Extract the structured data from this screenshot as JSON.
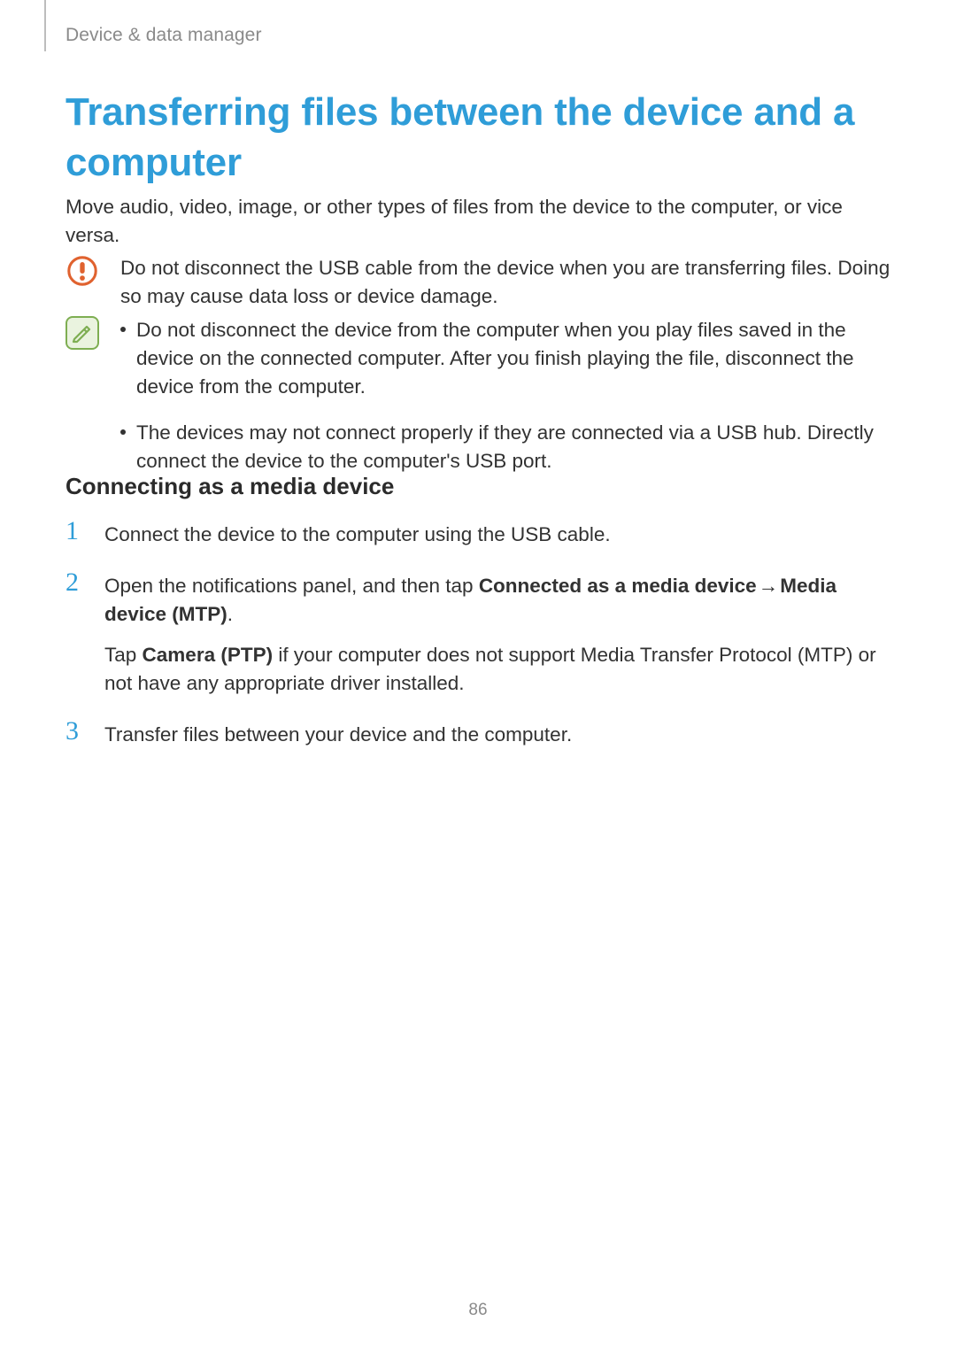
{
  "breadcrumb": "Device & data manager",
  "title": "Transferring files between the device and a computer",
  "intro": "Move audio, video, image, or other types of files from the device to the computer, or vice versa.",
  "warning": {
    "icon": "exclamation-circle-icon",
    "text": "Do not disconnect the USB cable from the device when you are transferring files. Doing so may cause data loss or device damage."
  },
  "note": {
    "icon": "note-pencil-icon",
    "items": [
      "Do not disconnect the device from the computer when you play files saved in the device on the connected computer. After you finish playing the file, disconnect the device from the computer.",
      "The devices may not connect properly if they are connected via a USB hub. Directly connect the device to the computer's USB port."
    ]
  },
  "subheading": "Connecting as a media device",
  "steps": {
    "s1": {
      "num": "1",
      "text": "Connect the device to the computer using the USB cable."
    },
    "s2": {
      "num": "2",
      "pre": "Open the notifications panel, and then tap ",
      "bold1": "Connected as a media device",
      "arrow": " → ",
      "bold2": "Media device (MTP)",
      "post": ".",
      "sub_pre": "Tap ",
      "sub_bold": "Camera (PTP)",
      "sub_post": " if your computer does not support Media Transfer Protocol (MTP) or not have any appropriate driver installed."
    },
    "s3": {
      "num": "3",
      "text": "Transfer files between your device and the computer."
    }
  },
  "page_number": "86"
}
